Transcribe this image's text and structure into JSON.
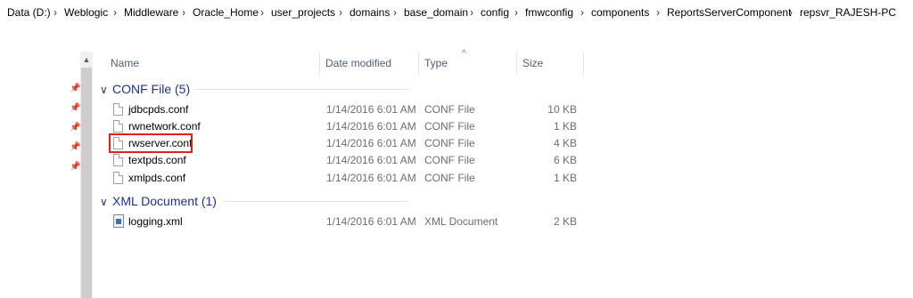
{
  "breadcrumb": [
    "Data (D:)",
    "Weblogic",
    "Middleware",
    "Oracle_Home",
    "user_projects",
    "domains",
    "base_domain",
    "config",
    "fmwconfig",
    "components",
    "ReportsServerComponent",
    "repsvr_RAJESH-PC"
  ],
  "breadcrumb_separator": "›",
  "columns": {
    "name": "Name",
    "date": "Date modified",
    "type": "Type",
    "size": "Size"
  },
  "groups": [
    {
      "label": "CONF File (5)",
      "files": [
        {
          "name": "jdbcpds.conf",
          "date": "1/14/2016 6:01 AM",
          "type": "CONF File",
          "size": "10 KB"
        },
        {
          "name": "rwnetwork.conf",
          "date": "1/14/2016 6:01 AM",
          "type": "CONF File",
          "size": "1 KB"
        },
        {
          "name": "rwserver.conf",
          "date": "1/14/2016 6:01 AM",
          "type": "CONF File",
          "size": "4 KB"
        },
        {
          "name": "textpds.conf",
          "date": "1/14/2016 6:01 AM",
          "type": "CONF File",
          "size": "6 KB"
        },
        {
          "name": "xmlpds.conf",
          "date": "1/14/2016 6:01 AM",
          "type": "CONF File",
          "size": "1 KB"
        }
      ]
    },
    {
      "label": "XML Document (1)",
      "files": [
        {
          "name": "logging.xml",
          "date": "1/14/2016 6:01 AM",
          "type": "XML Document",
          "size": "2 KB"
        }
      ]
    }
  ],
  "highlight_color": "#e01e1e",
  "group_color": "#1e3287"
}
